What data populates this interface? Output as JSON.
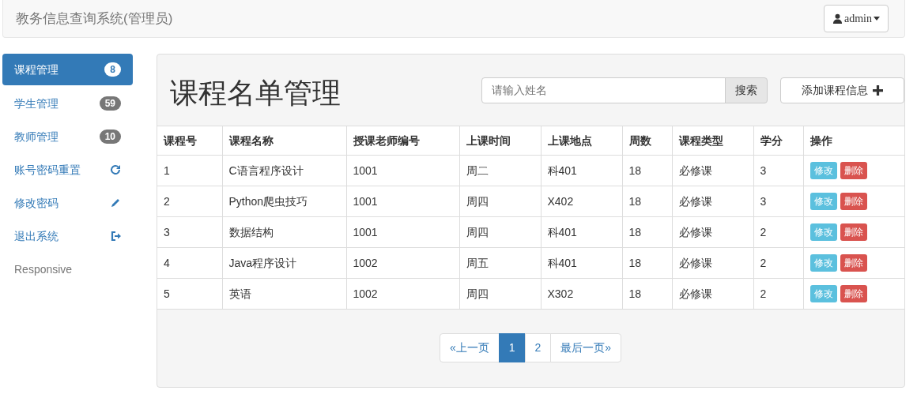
{
  "navbar": {
    "brand": "教务信息查询系统(管理员)",
    "user": "admin"
  },
  "sidebar": {
    "items": [
      {
        "label": "课程管理",
        "kind": "badge",
        "badge": "8",
        "selected": true
      },
      {
        "label": "学生管理",
        "kind": "badge",
        "badge": "59",
        "selected": false
      },
      {
        "label": "教师管理",
        "kind": "badge",
        "badge": "10",
        "selected": false
      },
      {
        "label": "账号密码重置",
        "kind": "refresh",
        "selected": false
      },
      {
        "label": "修改密码",
        "kind": "edit",
        "selected": false
      },
      {
        "label": "退出系统",
        "kind": "exit",
        "selected": false
      },
      {
        "label": "Responsive",
        "kind": "plain",
        "selected": false
      }
    ]
  },
  "panel": {
    "title": "课程名单管理",
    "search": {
      "placeholder": "请输入姓名",
      "button": "搜索"
    },
    "add_button": "添加课程信息"
  },
  "table": {
    "columns": [
      "课程号",
      "课程名称",
      "授课老师编号",
      "上课时间",
      "上课地点",
      "周数",
      "课程类型",
      "学分",
      "操作"
    ],
    "rows": [
      {
        "cells": [
          "1",
          "C语言程序设计",
          "1001",
          "周二",
          "科401",
          "18",
          "必修课",
          "3"
        ],
        "actions": [
          "修改",
          "删除"
        ]
      },
      {
        "cells": [
          "2",
          "Python爬虫技巧",
          "1001",
          "周四",
          "X402",
          "18",
          "必修课",
          "3"
        ],
        "actions": [
          "修改",
          "删除"
        ]
      },
      {
        "cells": [
          "3",
          "数据结构",
          "1001",
          "周四",
          "科401",
          "18",
          "必修课",
          "2"
        ],
        "actions": [
          "修改",
          "删除"
        ]
      },
      {
        "cells": [
          "4",
          "Java程序设计",
          "1002",
          "周五",
          "科401",
          "18",
          "必修课",
          "2"
        ],
        "actions": [
          "修改",
          "删除"
        ]
      },
      {
        "cells": [
          "5",
          "英语",
          "1002",
          "周四",
          "X302",
          "18",
          "必修课",
          "2"
        ],
        "actions": [
          "修改",
          "删除"
        ]
      }
    ]
  },
  "pagination": [
    {
      "label": "«上一页",
      "selected": false
    },
    {
      "label": "1",
      "selected": true
    },
    {
      "label": "2",
      "selected": false
    },
    {
      "label": "最后一页»",
      "selected": false
    }
  ]
}
